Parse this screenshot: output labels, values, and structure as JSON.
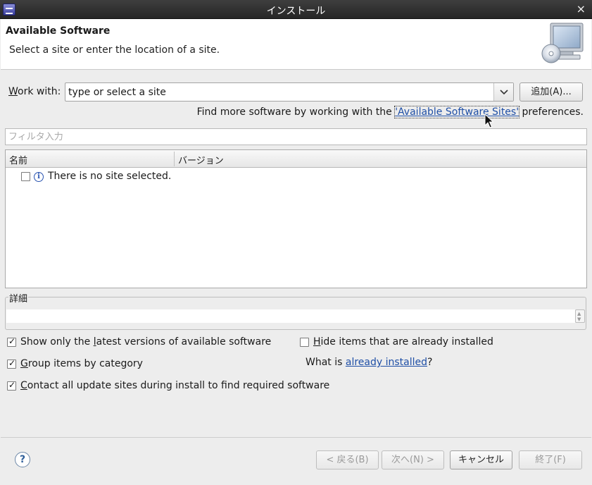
{
  "window": {
    "title": "インストール",
    "close_glyph": "×"
  },
  "header": {
    "title": "Available Software",
    "subtitle": "Select a site or enter the location of a site."
  },
  "work_with": {
    "label_prefix": "W",
    "label_rest": "ork with:",
    "value": "type or select a site",
    "add_button": "追加(A)..."
  },
  "find_more": {
    "prefix": "Find more software by working with the ",
    "link": "'Available Software Sites'",
    "suffix": " preferences."
  },
  "filter": {
    "placeholder": "フィルタ入力"
  },
  "table": {
    "columns": [
      "名前",
      "バージョン"
    ],
    "rows": [
      {
        "checked": false,
        "icon": "info-icon",
        "text": "There is no site selected."
      }
    ]
  },
  "details": {
    "label": "詳細"
  },
  "options": {
    "latest_pre": "Show only the ",
    "latest_ul": "l",
    "latest_post": "atest versions of available software",
    "latest_checked": true,
    "group_ul": "G",
    "group_post": "roup items by category",
    "group_checked": true,
    "contact_ul": "C",
    "contact_post": "ontact all update sites during install to find required software",
    "contact_checked": true,
    "hide_ul": "H",
    "hide_post": "ide items that are already installed",
    "hide_checked": false,
    "whatis_pre": "What is ",
    "whatis_link": "already installed",
    "whatis_post": "?"
  },
  "footer": {
    "help": "?",
    "back": "< 戻る(B)",
    "next": "次へ(N) >",
    "cancel": "キャンセル",
    "finish": "終了(F)"
  },
  "colors": {
    "link": "#1f4fa6",
    "titlebar": "#2e2e2e"
  }
}
